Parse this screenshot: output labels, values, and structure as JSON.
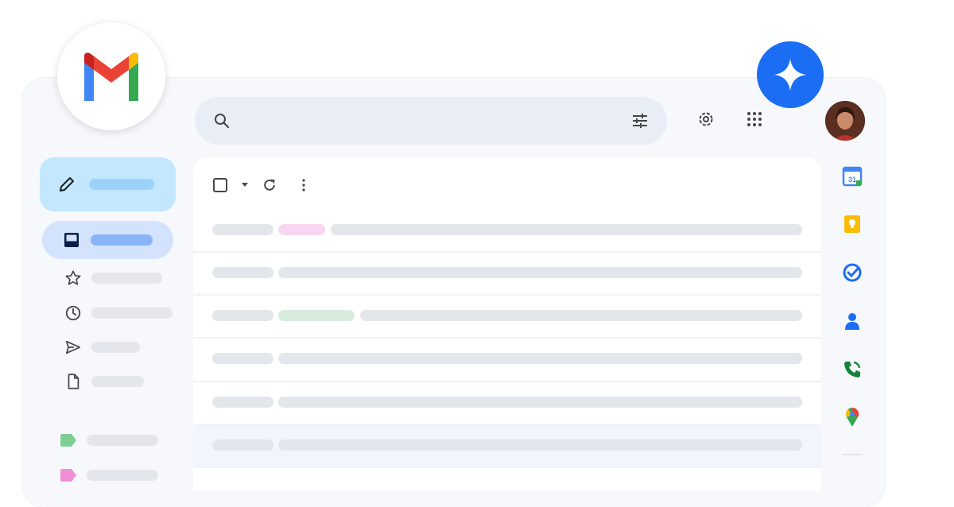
{
  "app": {
    "name": "Gmail",
    "logo_icon": "gmail-logo-icon",
    "assistant_icon": "gemini-sparkle-icon"
  },
  "colors": {
    "accent_blue": "#1b6ef3",
    "compose_bg": "#c2e7ff",
    "active_nav_bg": "#d3e3fd",
    "placeholder_bar": "#e3e6ea",
    "label_pink": "#f6d6f0",
    "label_green": "#d7ecdd"
  },
  "header": {
    "search": {
      "icon": "search-icon",
      "filter_icon": "tune-icon"
    },
    "settings_icon": "gear-icon",
    "apps_icon": "apps-grid-icon",
    "avatar": "user-avatar"
  },
  "compose": {
    "icon": "pencil-icon"
  },
  "sidebar": {
    "items": [
      {
        "icon": "inbox-icon",
        "active": true
      },
      {
        "icon": "star-icon"
      },
      {
        "icon": "clock-icon"
      },
      {
        "icon": "send-icon"
      },
      {
        "icon": "draft-icon"
      }
    ],
    "labels": [
      {
        "icon": "label-icon",
        "color": "#7ccf92"
      },
      {
        "icon": "label-icon",
        "color": "#f28fd6"
      }
    ]
  },
  "toolbar": {
    "icons": [
      "checkbox-icon",
      "caret-down-icon",
      "refresh-icon",
      "more-vert-icon"
    ]
  },
  "right_apps": [
    {
      "name": "calendar-icon",
      "text": "31"
    },
    {
      "name": "keep-icon"
    },
    {
      "name": "tasks-icon"
    },
    {
      "name": "contacts-icon"
    },
    {
      "name": "voice-icon"
    },
    {
      "name": "maps-icon"
    }
  ]
}
